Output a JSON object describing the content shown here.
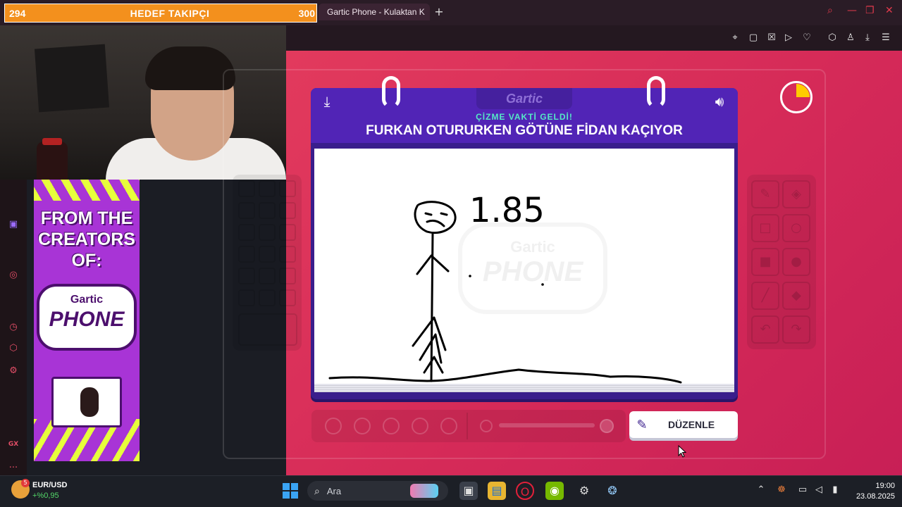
{
  "overlay": {
    "goal_current": "294",
    "goal_label": "HEDEF TAKIPÇI",
    "goal_max": "300"
  },
  "browser": {
    "tab_title": "Gartic Phone - Kulaktan K",
    "new_tab": "+",
    "toolbar_icons": [
      "pin-icon",
      "snapshot-icon",
      "shield-icon",
      "play-icon",
      "heart-icon",
      "extensions-icon",
      "profile-icon",
      "download-icon",
      "menu-icon"
    ],
    "window_icons": [
      "search-icon",
      "minimize-icon",
      "restore-icon",
      "close-icon"
    ]
  },
  "sidebar": {
    "icons": [
      "twitch-icon",
      "player-icon",
      "history-icon",
      "extensions-icon",
      "settings-icon",
      "gx-icon",
      "more-icon"
    ],
    "gx_label": "GX",
    "more_label": "..."
  },
  "ad": {
    "headline": "FROM THE CREATORS OF:",
    "logo_top": "Gartic",
    "logo_bottom": "PHONE",
    "colors": {
      "bg": "#a834d6",
      "accent": "#e7ff3b",
      "outline": "#4c0f6d"
    }
  },
  "game": {
    "logo": "Gartic",
    "subtitle": "ÇİZME VAKTİ GELDİ!",
    "prompt": "FURKAN OTURURKEN GÖTÜNE FİDAN KAÇIYOR",
    "canvas_text": "1.85",
    "watermark_top": "Gartic",
    "watermark_bottom": "PHONE",
    "edit_button": "DÜZENLE",
    "timer_fraction_elapsed": 0.25,
    "colors": {
      "background": "#d52a58",
      "card": "#3a1e8c",
      "header": "#5124b6",
      "subtitle": "#55e8c6",
      "timer": "#ffcc00"
    }
  },
  "taskbar": {
    "fx_badge": "5",
    "fx_pair": "EUR/USD",
    "fx_change": "+%0,95",
    "search_placeholder": "Ara",
    "apps": [
      "start-icon",
      "search-icon",
      "game-widget-icon",
      "task-view-icon",
      "file-explorer-icon",
      "opera-gx-icon",
      "nvidia-icon",
      "steam-alt-icon",
      "steam-icon"
    ],
    "tray_icons": [
      "chevron-up-icon",
      "microphone-icon",
      "display-icon",
      "volume-icon",
      "battery-icon"
    ],
    "time": "19:00",
    "date": "23.08.2025"
  }
}
